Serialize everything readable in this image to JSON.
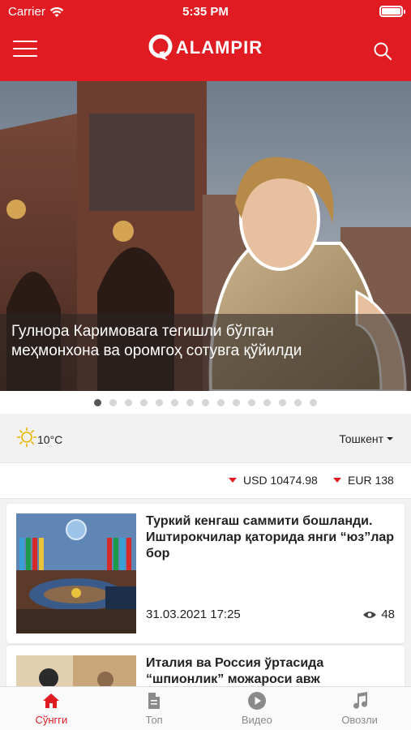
{
  "status_bar": {
    "carrier": "Carrier",
    "time": "5:35 PM",
    "battery_level": 1.0
  },
  "brand": {
    "logo_text": "ALAMPIR",
    "accent_color": "#e01b22"
  },
  "hero": {
    "caption": "Гулнора Каримовага тегишли бўлган меҳмонхона ва оромгоҳ сотувга қўйилди",
    "pager": {
      "total": 15,
      "active_index": 0
    }
  },
  "weather": {
    "icon": "sun-icon",
    "temperature": "10°C",
    "city": "Тошкент"
  },
  "currency": {
    "usd": {
      "label": "USD 10474.98",
      "trend": "down"
    },
    "eur": {
      "label": "EUR 138",
      "trend": "down"
    }
  },
  "news": [
    {
      "title": "Туркий кенгаш саммити бошланди. Иштирокчилар қаторида янги “юз”лар бор",
      "date": "31.03.2021 17:25",
      "views": "48"
    },
    {
      "title": "Италия ва Россия ўртасида “шпионлик” можароси авж"
    }
  ],
  "tabs": [
    {
      "label": "Сўнгги",
      "icon": "home-icon",
      "active": true
    },
    {
      "label": "Топ",
      "icon": "document-icon",
      "active": false
    },
    {
      "label": "Видео",
      "icon": "play-icon",
      "active": false
    },
    {
      "label": "Овозли",
      "icon": "music-note-icon",
      "active": false
    }
  ]
}
